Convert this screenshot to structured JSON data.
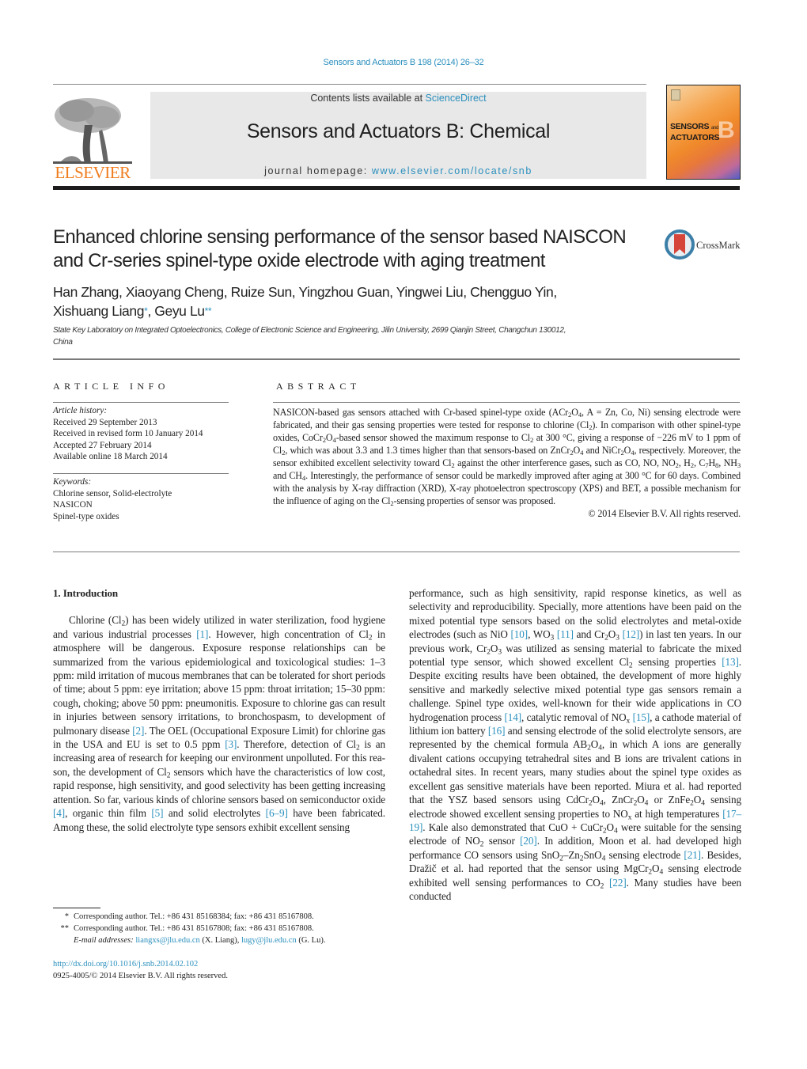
{
  "header": {
    "citation": "Sensors and Actuators B 198 (2014) 26–32",
    "publisher_logo_text": "ELSEVIER",
    "contents_prefix": "Contents lists available at ",
    "contents_link": "ScienceDirect",
    "journal_name": "Sensors and Actuators B: Chemical",
    "homepage_prefix": "journal homepage: ",
    "homepage_link": "www.elsevier.com/locate/snb",
    "cover": {
      "title_line1": "SENSORS",
      "title_and": "and",
      "title_line2": "ACTUATORS",
      "letter": "B"
    },
    "colors": {
      "link": "#2a8fbd",
      "elsevier_orange": "#f07d1e",
      "banner_bg": "#e8e8e8"
    }
  },
  "article": {
    "title_line1": "Enhanced chlorine sensing performance of the sensor based NAISCON",
    "title_line2": "and Cr-series spinel-type oxide electrode with aging treatment",
    "crossmark_label": "CrossMark",
    "authors_line1": "Han Zhang, Xiaoyang Cheng, Ruize Sun, Yingzhou Guan, Yingwei Liu, Chengguo Yin,",
    "author_liang": "Xishuang Liang",
    "author_liang_mark": "*",
    "author_sep": ", ",
    "author_lu": "Geyu Lu",
    "author_lu_mark": "**",
    "affiliation_line1": "State Key Laboratory on Integrated Optoelectronics, College of Electronic Science and Engineering, Jilin University, 2699 Qianjin Street, Changchun 130012,",
    "affiliation_line2": "China"
  },
  "article_info": {
    "label": "ARTICLE INFO",
    "history_head": "Article history:",
    "history": [
      "Received 29 September 2013",
      "Received in revised form 10 January 2014",
      "Accepted 27 February 2014",
      "Available online 18 March 2014"
    ],
    "keywords_head": "Keywords:",
    "keywords": [
      "Chlorine sensor, Solid-electrolyte",
      "NASICON",
      "Spinel-type oxides"
    ]
  },
  "abstract": {
    "label": "ABSTRACT",
    "copyright": "© 2014 Elsevier B.V. All rights reserved."
  },
  "intro": {
    "heading": "1.  Introduction"
  },
  "footnotes": {
    "fn1_mark": "*",
    "fn1_text": "Corresponding author. Tel.: +86 431 85168384; fax: +86 431 85167808.",
    "fn2_mark": "**",
    "fn2_text": "Corresponding author. Tel.: +86 431 85167808; fax: +86 431 85167808.",
    "email_label": "E-mail addresses:",
    "email1": "liangxs@jlu.edu.cn",
    "email1_owner": " (X. Liang), ",
    "email2": "lugy@jlu.edu.cn",
    "email2_owner": " (G. Lu).",
    "doi": "http://dx.doi.org/10.1016/j.snb.2014.02.102",
    "issn_copyright": "0925-4005/© 2014 Elsevier B.V. All rights reserved."
  }
}
